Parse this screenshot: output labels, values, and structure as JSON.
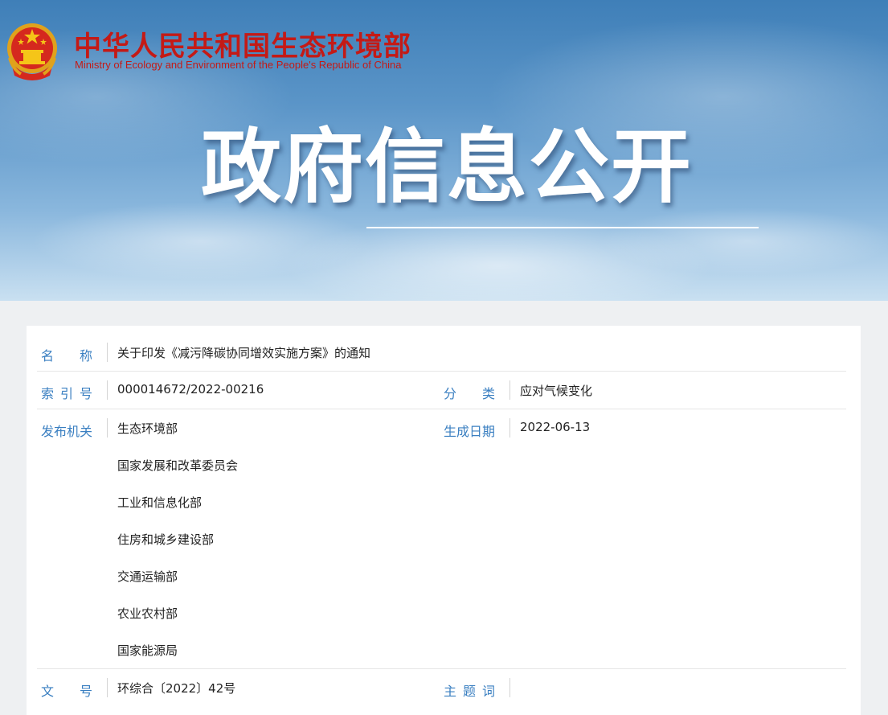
{
  "header": {
    "site_name_cn": "中华人民共和国生态环境部",
    "site_name_en": "Ministry of Ecology and Environment of the People's Republic of China",
    "banner_title": "政府信息公开",
    "emblem_icon": "national-emblem-icon"
  },
  "colors": {
    "brand_red": "#c41a16",
    "label_blue": "#3a7fc1",
    "text": "#222222"
  },
  "info": {
    "name_label": "名　　称",
    "name_value": "关于印发《减污降碳协同增效实施方案》的通知",
    "index_label": "索引号",
    "index_value": "000014672/2022-00216",
    "category_label": "分　　类",
    "category_value": "应对气候变化",
    "issuer_label": "发布机关",
    "issuers": [
      "生态环境部",
      "国家发展和改革委员会",
      "工业和信息化部",
      "住房和城乡建设部",
      "交通运输部",
      "农业农村部",
      "国家能源局"
    ],
    "date_label": "生成日期",
    "date_value": "2022-06-13",
    "doc_no_label": "文　　号",
    "doc_no_value": "环综合〔2022〕42号",
    "keywords_label": "主题词",
    "keywords_value": ""
  }
}
